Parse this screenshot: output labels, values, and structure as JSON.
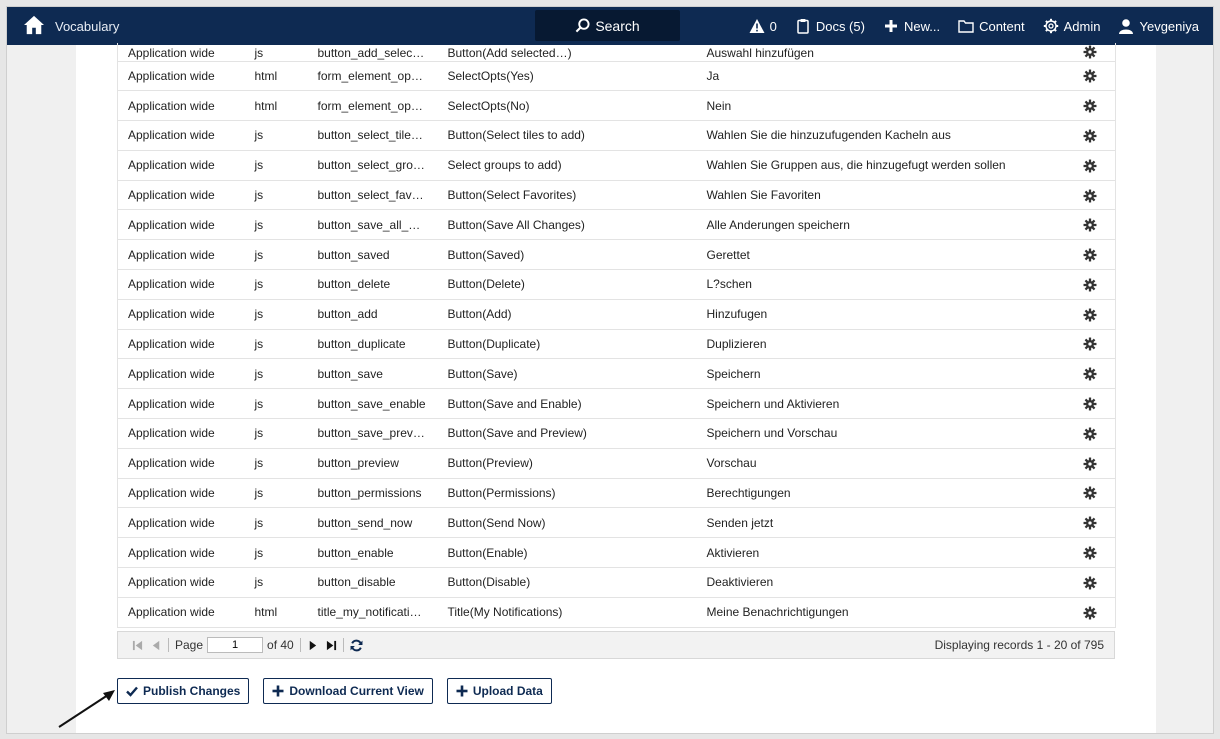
{
  "navbar": {
    "title": "Vocabulary",
    "search_label": "Search",
    "alerts_count": "0",
    "docs_label": "Docs (5)",
    "new_label": "New...",
    "content_label": "Content",
    "admin_label": "Admin",
    "user_label": "Yevgeniya"
  },
  "table": {
    "partial_row": [
      "Application wide",
      "js",
      "button_add_selec…",
      "Button(Add selected…)",
      "Auswahl hinzufügen"
    ],
    "rows": [
      [
        "Application wide",
        "html",
        "form_element_op…",
        "SelectOpts(Yes)",
        "Ja"
      ],
      [
        "Application wide",
        "html",
        "form_element_op…",
        "SelectOpts(No)",
        "Nein"
      ],
      [
        "Application wide",
        "js",
        "button_select_tile…",
        "Button(Select tiles to add)",
        "Wahlen Sie die hinzuzufugenden Kacheln aus"
      ],
      [
        "Application wide",
        "js",
        "button_select_gro…",
        "Select groups to add)",
        "Wahlen Sie Gruppen aus, die hinzugefugt werden sollen"
      ],
      [
        "Application wide",
        "js",
        "button_select_fav…",
        "Button(Select Favorites)",
        "Wahlen Sie Favoriten"
      ],
      [
        "Application wide",
        "js",
        "button_save_all_…",
        "Button(Save All Changes)",
        "Alle Anderungen speichern"
      ],
      [
        "Application wide",
        "js",
        "button_saved",
        "Button(Saved)",
        "Gerettet"
      ],
      [
        "Application wide",
        "js",
        "button_delete",
        "Button(Delete)",
        "L?schen"
      ],
      [
        "Application wide",
        "js",
        "button_add",
        "Button(Add)",
        "Hinzufugen"
      ],
      [
        "Application wide",
        "js",
        "button_duplicate",
        "Button(Duplicate)",
        "Duplizieren"
      ],
      [
        "Application wide",
        "js",
        "button_save",
        "Button(Save)",
        "Speichern"
      ],
      [
        "Application wide",
        "js",
        "button_save_enable",
        "Button(Save and Enable)",
        "Speichern und Aktivieren"
      ],
      [
        "Application wide",
        "js",
        "button_save_prev…",
        "Button(Save and Preview)",
        "Speichern und Vorschau"
      ],
      [
        "Application wide",
        "js",
        "button_preview",
        "Button(Preview)",
        "Vorschau"
      ],
      [
        "Application wide",
        "js",
        "button_permissions",
        "Button(Permissions)",
        "Berechtigungen"
      ],
      [
        "Application wide",
        "js",
        "button_send_now",
        "Button(Send Now)",
        "Senden jetzt"
      ],
      [
        "Application wide",
        "js",
        "button_enable",
        "Button(Enable)",
        "Aktivieren"
      ],
      [
        "Application wide",
        "js",
        "button_disable",
        "Button(Disable)",
        "Deaktivieren"
      ],
      [
        "Application wide",
        "html",
        "title_my_notificati…",
        "Title(My Notifications)",
        "Meine Benachrichtigungen"
      ]
    ]
  },
  "pager": {
    "page_label": "Page",
    "page_value": "1",
    "of_label": "of 40",
    "display_text": "Displaying records 1 - 20 of 795"
  },
  "actions": {
    "publish_label": "Publish Changes",
    "download_label": "Download Current View",
    "upload_label": "Upload Data"
  },
  "colors": {
    "navbar": "#0e2a52",
    "accent": "#0e2a52"
  }
}
